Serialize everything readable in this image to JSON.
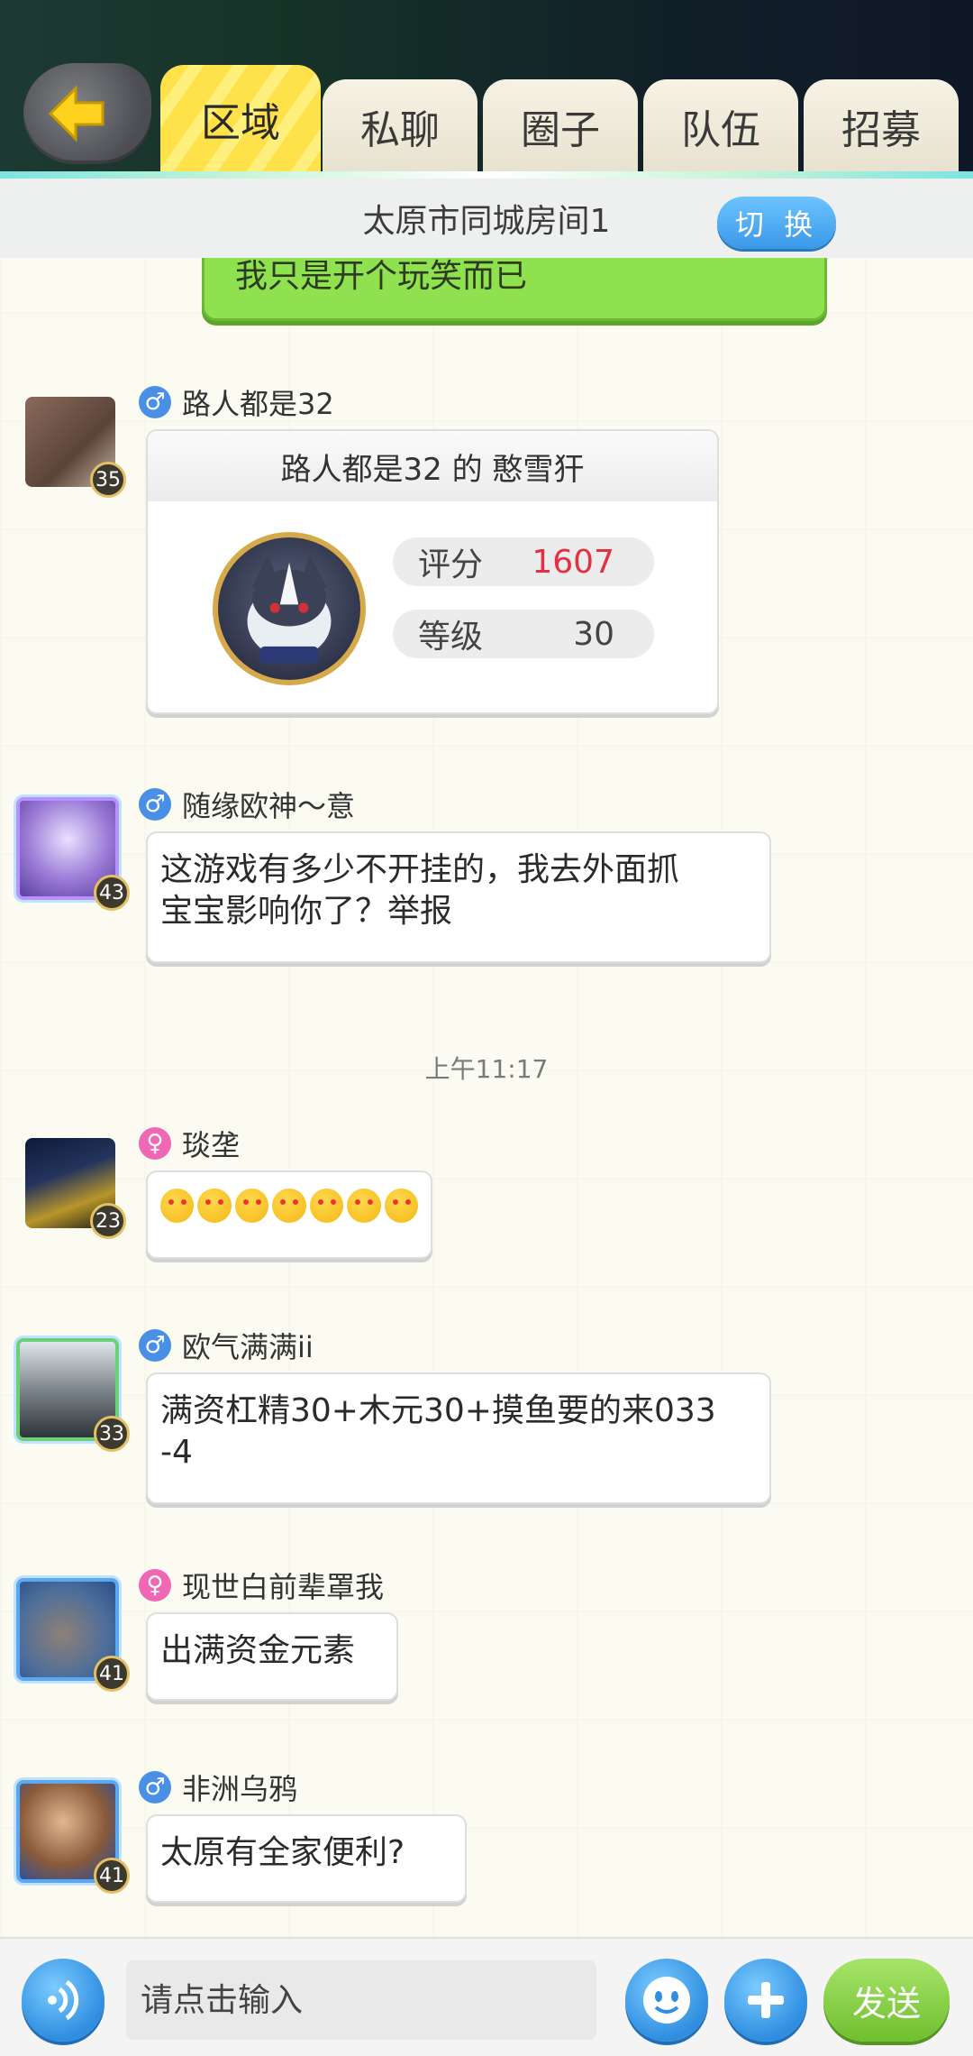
{
  "tabs": [
    {
      "label": "区域"
    },
    {
      "label": "私聊"
    },
    {
      "label": "圈子"
    },
    {
      "label": "队伍"
    },
    {
      "label": "招募"
    }
  ],
  "room": {
    "name": "太原市同城房间1",
    "switch_label": "切 换"
  },
  "my_message": {
    "text": "我只是开个玩笑而已"
  },
  "card_message": {
    "user": "路人都是32",
    "gender": "male",
    "level": "35",
    "title": "路人都是32 的 憨雪犴",
    "score_label": "评分",
    "score_value": "1607",
    "grade_label": "等级",
    "grade_value": "30"
  },
  "messages": [
    {
      "user": "随缘欧神～意",
      "gender": "male",
      "level": "43",
      "text_lines": [
        "这游戏有多少不开挂的，我去外面抓",
        "宝宝影响你了？举报"
      ]
    },
    {
      "user": "琰垄",
      "gender": "female",
      "level": "23",
      "emoji_count": 7
    },
    {
      "user": "欧气满满ii",
      "gender": "male",
      "level": "33",
      "text_lines": [
        "满资杠精30+木元30+摸鱼要的来033",
        "-4"
      ]
    },
    {
      "user": "现世白前辈罩我",
      "gender": "female",
      "level": "41",
      "text_lines": [
        "出满资金元素"
      ]
    },
    {
      "user": "非洲乌鸦",
      "gender": "male",
      "level": "41",
      "text_lines": [
        "太原有全家便利?"
      ]
    }
  ],
  "timestamp": "上午11:17",
  "input": {
    "placeholder": "请点击输入"
  },
  "send_label": "发送",
  "colors": {
    "accent_blue": "#3a98e8",
    "send_green": "#6fbf2f",
    "tab_active": "#ffe24a",
    "score_red": "#e43044"
  }
}
